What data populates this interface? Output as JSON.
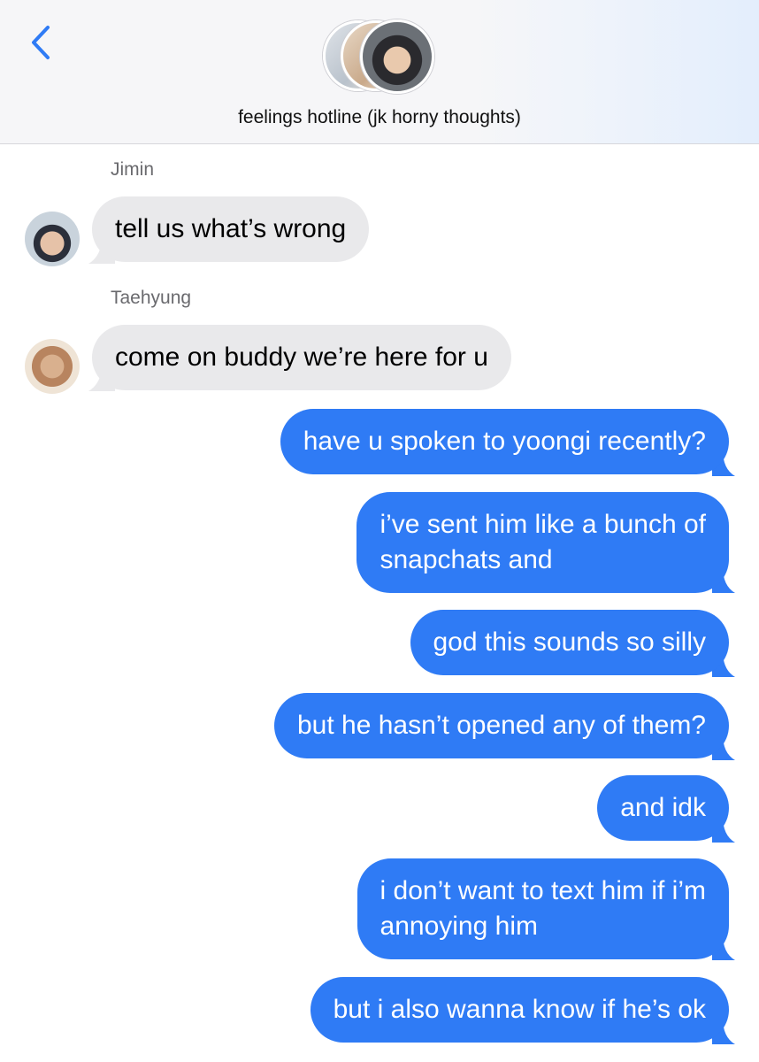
{
  "header": {
    "title": "feelings hotline (jk horny thoughts)"
  },
  "messages": [
    {
      "sender": "Jimin",
      "direction": "in",
      "text": "tell us what’s wrong"
    },
    {
      "sender": "Taehyung",
      "direction": "in",
      "text": "come on buddy we’re here for u"
    },
    {
      "direction": "out",
      "text": "have u spoken to yoongi recently?"
    },
    {
      "direction": "out",
      "text_line1": "i’ve sent him like a bunch of",
      "text_line2": "snapchats and"
    },
    {
      "direction": "out",
      "text": "god this sounds so silly"
    },
    {
      "direction": "out",
      "text": "but he hasn’t opened any of them?"
    },
    {
      "direction": "out",
      "text": "and idk"
    },
    {
      "direction": "out",
      "text_line1": "i don’t want to text him if i’m",
      "text_line2": "annoying him"
    },
    {
      "direction": "out",
      "text": "but i also wanna know if he’s ok"
    }
  ],
  "colors": {
    "outgoing_bubble": "#2f7bf5",
    "incoming_bubble": "#e9e9eb",
    "accent": "#2f7bf5"
  },
  "icons": {
    "back": "chevron-left-icon"
  }
}
